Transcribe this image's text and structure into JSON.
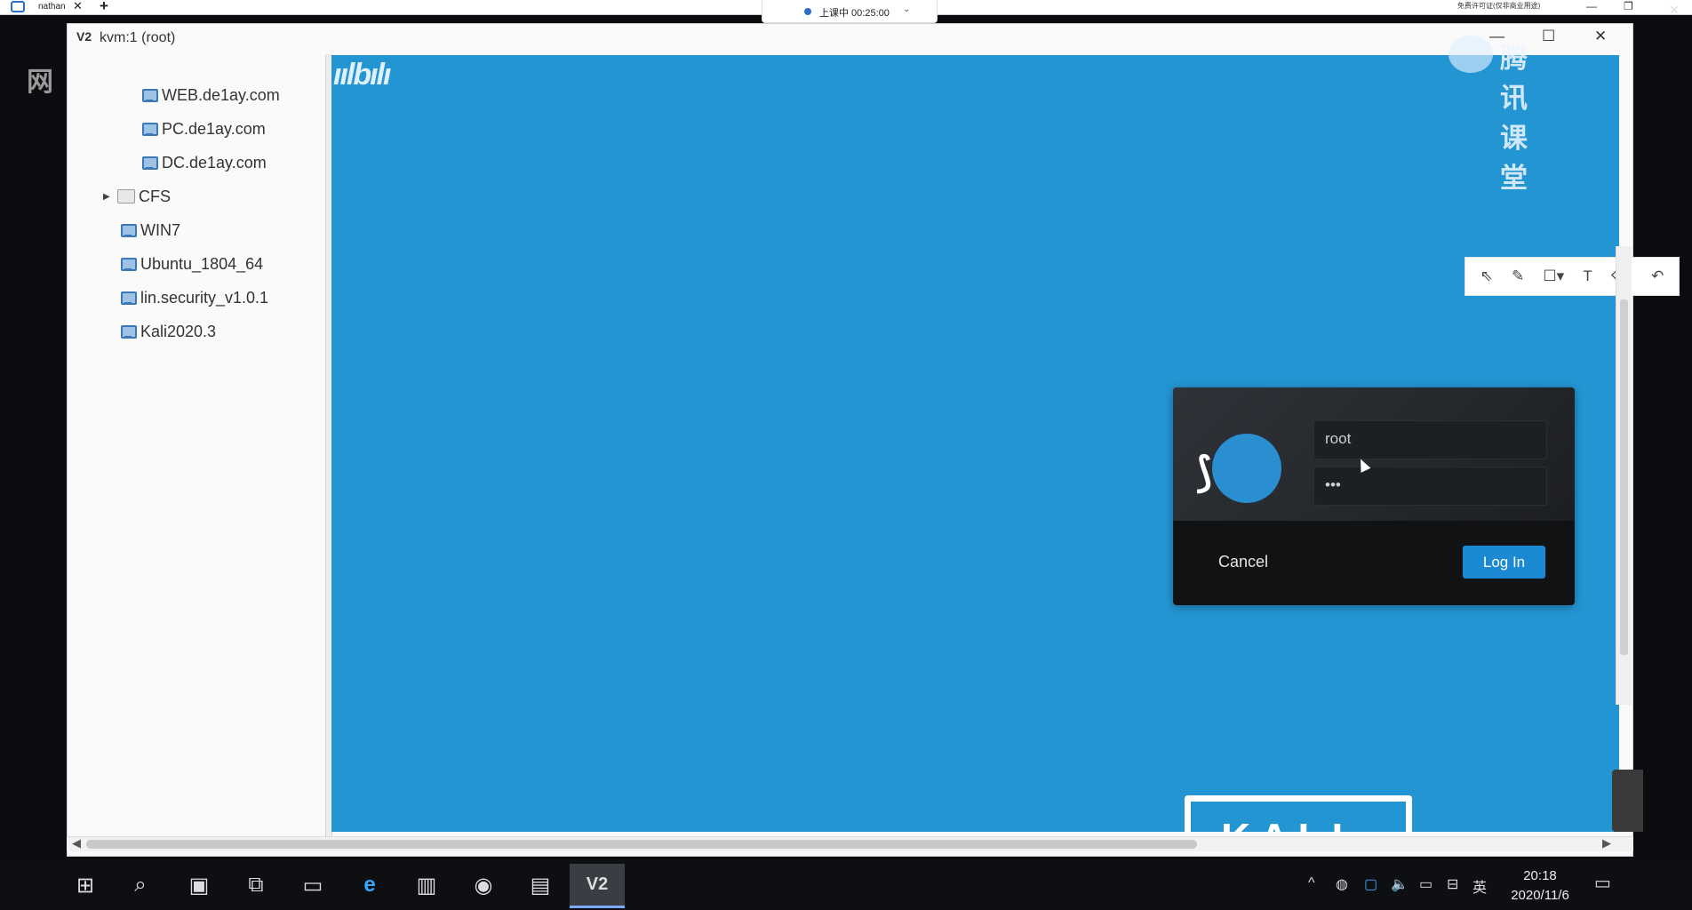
{
  "topbar": {
    "tab_title": "nathan",
    "tab_close": "✕",
    "tab_add": "+",
    "class_status": "上课中 00:25:00",
    "license_note": "免费许可证(仅非商业用途)",
    "minimize": "—",
    "restore": "❐",
    "close": "✕"
  },
  "left_panel": {
    "big_text": "网"
  },
  "vm_window": {
    "title": "kvm:1 (root)",
    "title_icon_text": "V2",
    "controls": {
      "minimize": "—",
      "maximize": "☐",
      "close": "✕"
    }
  },
  "tree": {
    "items": [
      {
        "label": "WEB.de1ay.com",
        "kind": "vm"
      },
      {
        "label": "PC.de1ay.com",
        "kind": "vm"
      },
      {
        "label": "DC.de1ay.com",
        "kind": "vm"
      },
      {
        "label": "CFS",
        "kind": "folder"
      },
      {
        "label": "WIN7",
        "kind": "vm"
      },
      {
        "label": "Ubuntu_1804_64",
        "kind": "vm"
      },
      {
        "label": "lin.security_v1.0.1",
        "kind": "vm"
      },
      {
        "label": "Kali2020.3",
        "kind": "vm"
      }
    ]
  },
  "console": {
    "top_logo": "ıılbılı",
    "bottom_logo": "KALI",
    "login": {
      "username": "root",
      "password_mask": "•••",
      "cancel_label": "Cancel",
      "login_label": "Log In"
    }
  },
  "drawbar": {
    "tools": [
      "select-icon",
      "pen-icon",
      "rectangle-icon",
      "text-icon",
      "eraser-icon",
      "undo-icon"
    ],
    "glyphs": [
      "⇖",
      "✎",
      "☐▾",
      "T",
      "⌫",
      "↶"
    ]
  },
  "watermark": {
    "text": "腾讯课堂"
  },
  "taskbar": {
    "icons": [
      "windows-start-icon",
      "search-icon",
      "task-manager-icon",
      "virtual-desktop-icon",
      "file-explorer-icon",
      "edge-browser-icon",
      "app-icon",
      "chrome-icon",
      "terminal-icon",
      "virt-manager-icon"
    ],
    "glyphs": [
      "⊞",
      "⌕",
      "▣",
      "⧉",
      "▭",
      "e",
      "▥",
      "◉",
      "▤",
      "V2"
    ],
    "tray_glyphs": [
      "^",
      "◍",
      "▢",
      "🔈",
      "▭",
      "⊟",
      "英"
    ],
    "time": "20:18",
    "date": "2020/11/6"
  },
  "colors": {
    "desktop_bg": "#2495d3",
    "login_button": "#1b8ad3",
    "dialog_bg": "#101214"
  }
}
